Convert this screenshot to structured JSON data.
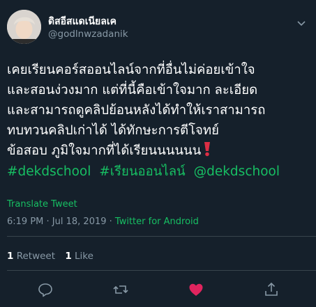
{
  "user": {
    "display_name": "ดิสอีสแดเนียลเค",
    "handle": "@godlnwzadanik"
  },
  "tweet": {
    "lines": [
      "เคยเรียนคอร์สออนไลน์จากที่อื่นไม่ค่อยเข้าใจ",
      "และสอนง่วงมาก แต่ที่นี้คือเข้าใจมาก ละเอียด",
      "และสามารถดูคลิปย้อนหลังได้ทำให้เราสามารถ",
      "ทบทวนคลิปเก่าได้ ได้ทักษะการตีโจทย์",
      "ข้อสอบ  ภูมิใจมากที่ได้เรียนนนนนน"
    ],
    "emoji": "heavy-exclamation-mark",
    "hashtags": [
      "#dekdschool",
      "#เรียนออนไลน์",
      "@dekdschool"
    ]
  },
  "translate_label": "Translate Tweet",
  "meta": {
    "time": "6:19 PM",
    "separator1": " · ",
    "date": "Jul 18, 2019",
    "separator2": " · ",
    "source": "Twitter for Android"
  },
  "stats": {
    "retweets_count": "1",
    "retweets_label": " Retweet",
    "likes_count": "1",
    "likes_label": " Like"
  },
  "actions": {
    "reply": "reply-icon",
    "retweet": "retweet-icon",
    "like": "heart-icon",
    "share": "share-icon"
  },
  "colors": {
    "background": "#15202b",
    "accent": "#17bf63",
    "muted": "#8899a6",
    "like": "#e0245e",
    "divider": "#38444d"
  }
}
